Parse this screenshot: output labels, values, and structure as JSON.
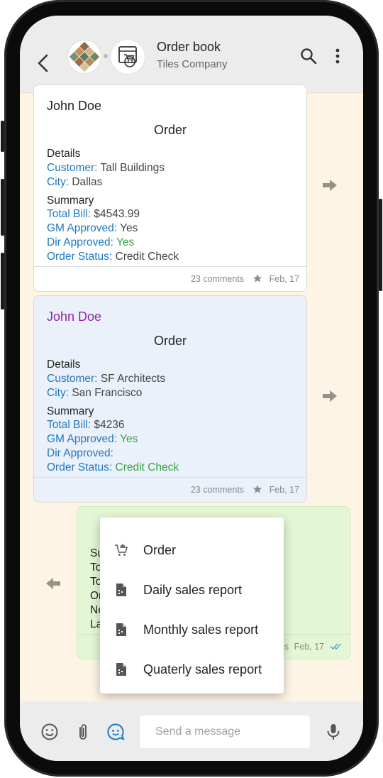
{
  "header": {
    "title": "Order book",
    "subtitle": "Tiles Company"
  },
  "cards": [
    {
      "author": "John Doe",
      "author_color": "#222222",
      "type": "Order",
      "details_heading": "Details",
      "customer_label": "Customer:",
      "customer": "Tall Buildings",
      "city_label": "City:",
      "city": "Dallas",
      "summary_heading": "Summary",
      "total_label": "Total Bill:",
      "total": "$4543.99",
      "gm_label": "GM Approved:",
      "gm": "Yes",
      "dir_label": "Dir Approved:",
      "dir": "Yes",
      "status_label": "Order Status:",
      "status": "Credit Check",
      "comments": "23 comments",
      "date": "Feb, 17"
    },
    {
      "author": "John Doe",
      "author_color": "#8e24aa",
      "type": "Order",
      "details_heading": "Details",
      "customer_label": "Customer:",
      "customer": "SF Architects",
      "city_label": "City:",
      "city": "San Francisco",
      "summary_heading": "Summary",
      "total_label": "Total Bill:",
      "total": "$4236",
      "gm_label": "GM Approved:",
      "gm": "Yes",
      "dir_label": "Dir Approved:",
      "dir": "",
      "status_label": "Order Status:",
      "status": "Credit Check",
      "comments": "23 comments",
      "date": "Feb, 17"
    },
    {
      "partial_summary": "Su",
      "partial_lines": [
        "To",
        "To",
        "Or",
        "Ne",
        "La"
      ],
      "partial_footer": "s",
      "date": "Feb, 17"
    }
  ],
  "menu": {
    "items": [
      {
        "label": "Order",
        "icon": "cart-plus-icon"
      },
      {
        "label": "Daily sales report",
        "icon": "document-icon"
      },
      {
        "label": "Monthly sales report",
        "icon": "document-icon"
      },
      {
        "label": "Quaterly sales report",
        "icon": "document-icon"
      }
    ]
  },
  "composer": {
    "placeholder": "Send a message"
  },
  "colors": {
    "accent": "#1e78c2",
    "green": "#3aa046",
    "card_blue": "#ebf1fa",
    "card_green": "#e4f7d5",
    "chat_bg": "#fdf4e6"
  }
}
